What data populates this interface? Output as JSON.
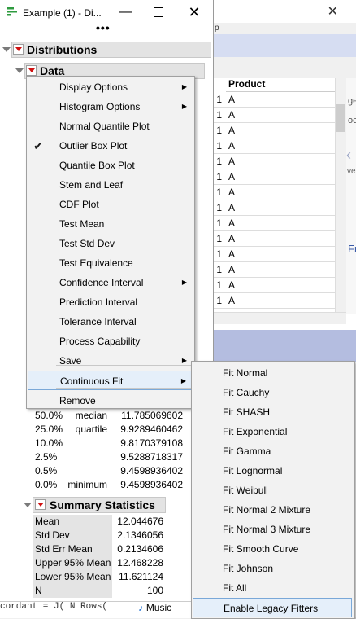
{
  "window": {
    "title": "Example (1) - Di...",
    "minimize": "—",
    "close": "✕",
    "more": "•••"
  },
  "report": {
    "distributions": "Distributions",
    "data": "Data",
    "quantiles": [
      {
        "pct": "50.0%",
        "label": "median",
        "value": "11.785069602"
      },
      {
        "pct": "25.0%",
        "label": "quartile",
        "value": "9.9289460462"
      },
      {
        "pct": "10.0%",
        "label": "",
        "value": "9.8170379108"
      },
      {
        "pct": "2.5%",
        "label": "",
        "value": "9.5288718317"
      },
      {
        "pct": "0.5%",
        "label": "",
        "value": "9.4598936402"
      },
      {
        "pct": "0.0%",
        "label": "minimum",
        "value": "9.4598936402"
      }
    ],
    "summary_title": "Summary Statistics",
    "summary": [
      {
        "label": "Mean",
        "value": "12.044676"
      },
      {
        "label": "Std Dev",
        "value": "2.1346056"
      },
      {
        "label": "Std Err Mean",
        "value": "0.2134606"
      },
      {
        "label": "Upper 95% Mean",
        "value": "12.468228"
      },
      {
        "label": "Lower 95% Mean",
        "value": "11.621124"
      },
      {
        "label": "N",
        "value": "100"
      }
    ],
    "script_line": "cordant = J( N Rows(",
    "music": "Music"
  },
  "context_menu": {
    "items": [
      {
        "label": "Display Options",
        "submenu": true
      },
      {
        "label": "Histogram Options",
        "submenu": true
      },
      {
        "label": "Normal Quantile Plot"
      },
      {
        "label": "Outlier Box Plot",
        "checked": true
      },
      {
        "label": "Quantile Box Plot"
      },
      {
        "label": "Stem and Leaf"
      },
      {
        "label": "CDF Plot"
      },
      {
        "label": "Test Mean"
      },
      {
        "label": "Test Std Dev"
      },
      {
        "label": "Test Equivalence"
      },
      {
        "label": "Confidence Interval",
        "submenu": true
      },
      {
        "label": "Prediction Interval"
      },
      {
        "label": "Tolerance Interval"
      },
      {
        "label": "Process Capability"
      },
      {
        "label": "Save",
        "submenu": true
      },
      {
        "label": "Continuous Fit",
        "submenu": true,
        "highlighted": true
      },
      {
        "label": "Remove"
      }
    ],
    "check_glyph": "✔",
    "arrow_glyph": "▶"
  },
  "fit_submenu": {
    "items": [
      "Fit Normal",
      "Fit Cauchy",
      "Fit SHASH",
      "Fit Exponential",
      "Fit Gamma",
      "Fit Lognormal",
      "Fit Weibull",
      "Fit Normal 2 Mixture",
      "Fit Normal 3 Mixture",
      "Fit Smooth Curve",
      "Fit Johnson",
      "Fit All",
      "Enable Legacy Fitters"
    ]
  },
  "data_table": {
    "menu_fragment": "p",
    "close": "✕",
    "column_header": "Product",
    "rows": [
      {
        "n": "1",
        "product": "A"
      },
      {
        "n": "1",
        "product": "A"
      },
      {
        "n": "1",
        "product": "A"
      },
      {
        "n": "1",
        "product": "A"
      },
      {
        "n": "1",
        "product": "A"
      },
      {
        "n": "1",
        "product": "A"
      },
      {
        "n": "1",
        "product": "A"
      },
      {
        "n": "1",
        "product": "A"
      },
      {
        "n": "1",
        "product": "A"
      },
      {
        "n": "1",
        "product": "A"
      },
      {
        "n": "1",
        "product": "A"
      },
      {
        "n": "1",
        "product": "A"
      },
      {
        "n": "1",
        "product": "A"
      },
      {
        "n": "1",
        "product": "A"
      }
    ],
    "edge_text_1": "ge",
    "edge_text_2": "oc",
    "edge_text_3": "Fr",
    "edge_text_4": "ve"
  },
  "colors": {
    "red_triangle": "#d01010",
    "highlight": "#e5effa",
    "highlight_border": "#7aa8d8",
    "blue_band": "#d6ddf2"
  }
}
